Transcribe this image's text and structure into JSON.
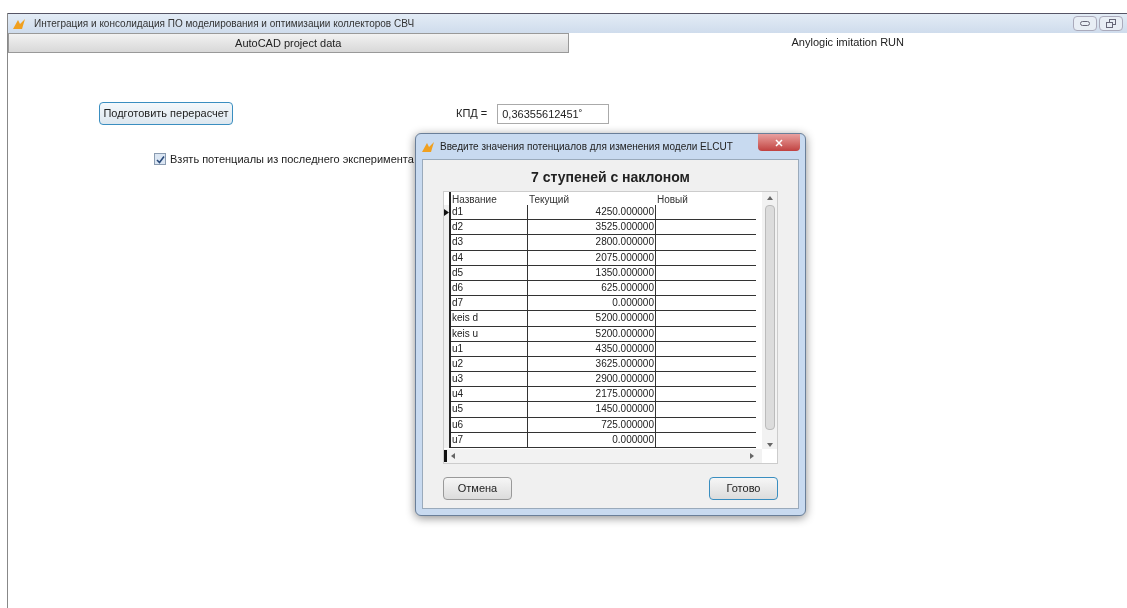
{
  "window": {
    "title": "Интеграция и  консолидация ПО моделирования и оптимизации коллекторов СВЧ"
  },
  "tabs": [
    {
      "label": "AutoCAD project data",
      "selected": false
    },
    {
      "label": "Anylogic imitation RUN",
      "selected": true
    }
  ],
  "recalc_button": "Подготовить перерасчет",
  "efficiency": {
    "label": "КПД =",
    "value": "0,36355612451˚"
  },
  "last_experiment": {
    "label": "Взять потенциалы из последнего эксперимента",
    "checked": true
  },
  "dialog": {
    "title": "Введите значения потенциалов для изменения модели ELCUT",
    "heading": "7 ступеней с наклоном",
    "columns": [
      "Название",
      "Текущий",
      "Новый"
    ],
    "rows": [
      {
        "name": "d1",
        "current": "4250.000000",
        "selected": true
      },
      {
        "name": "d2",
        "current": "3525.000000",
        "selected": false
      },
      {
        "name": "d3",
        "current": "2800.000000",
        "selected": false
      },
      {
        "name": "d4",
        "current": "2075.000000",
        "selected": false
      },
      {
        "name": "d5",
        "current": "1350.000000",
        "selected": false
      },
      {
        "name": "d6",
        "current": "625.000000",
        "selected": false
      },
      {
        "name": "d7",
        "current": "0.000000",
        "selected": false
      },
      {
        "name": "keis d",
        "current": "5200.000000",
        "selected": false
      },
      {
        "name": "keis u",
        "current": "5200.000000",
        "selected": false
      },
      {
        "name": "u1",
        "current": "4350.000000",
        "selected": false
      },
      {
        "name": "u2",
        "current": "3625.000000",
        "selected": false
      },
      {
        "name": "u3",
        "current": "2900.000000",
        "selected": false
      },
      {
        "name": "u4",
        "current": "2175.000000",
        "selected": false
      },
      {
        "name": "u5",
        "current": "1450.000000",
        "selected": false
      },
      {
        "name": "u6",
        "current": "725.000000",
        "selected": false
      },
      {
        "name": "u7",
        "current": "0.000000",
        "selected": false
      }
    ],
    "buttons": [
      "Отмена",
      "Готово"
    ]
  }
}
